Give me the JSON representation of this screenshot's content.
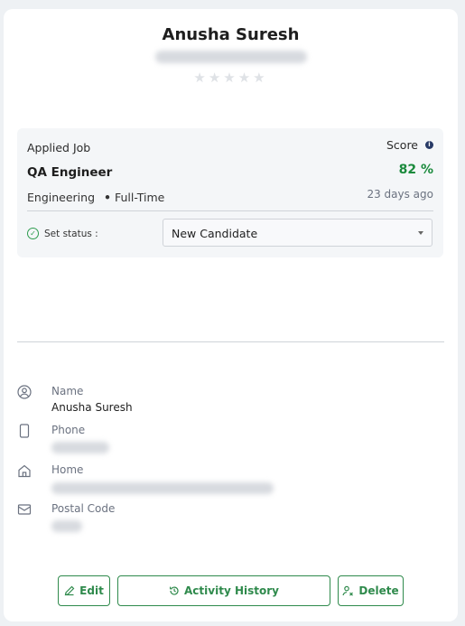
{
  "candidate": {
    "name": "Anusha Suresh",
    "rating_stars": "★★★★★",
    "rating_value": 0,
    "rating_max": 5
  },
  "job": {
    "applied_label": "Applied Job",
    "score_label": "Score",
    "title": "QA Engineer",
    "score": "82 %",
    "department": "Engineering",
    "type": "Full-Time",
    "separator": "•",
    "posted": "23 days ago",
    "status_label": "Set status :",
    "status_value": "New Candidate"
  },
  "details": {
    "name_label": "Name",
    "name_value": "Anusha Suresh",
    "phone_label": "Phone",
    "home_label": "Home",
    "postal_label": "Postal Code"
  },
  "actions": {
    "edit": "Edit",
    "history": "Activity History",
    "delete": "Delete"
  },
  "colors": {
    "accent": "#2f8a4c",
    "score": "#1a8a3c",
    "info": "#283a66"
  }
}
